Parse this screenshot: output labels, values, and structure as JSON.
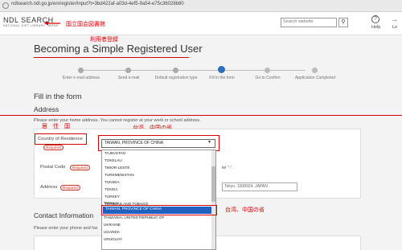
{
  "browser": {
    "url": "ndlsearch.ndl.go.jp/en/register/input?t=3bd422af-a03d-4ef5-9a54-e75c36028b80"
  },
  "header": {
    "logo": "NDL SEARCH",
    "logo_sub": "NATIONAL DIET LIBRARY, JAPAN",
    "search_placeholder": "Search website",
    "search_icon": "magnifier-icon",
    "help_label": "Help",
    "login_label": "Lo"
  },
  "annotations": {
    "ndl": "国立国会図書館",
    "user_reg": "利用者登録",
    "residence": "居　住　国",
    "taiwan_top": "台湾、中国の省",
    "taiwan_bottom": "台湾、中国の省",
    "color": "#d40000"
  },
  "page": {
    "title": "Becoming a Simple Registered User"
  },
  "steps": [
    {
      "label": "Enter e-mail address",
      "state": "done"
    },
    {
      "label": "Send e-mail",
      "state": "done"
    },
    {
      "label": "Default registration type",
      "state": "done"
    },
    {
      "label": "Fill in the form",
      "state": "current"
    },
    {
      "label": "Go to Confirm",
      "state": "todo"
    },
    {
      "label": "Application Completed",
      "state": "todo"
    }
  ],
  "form": {
    "heading": "Fill in the form",
    "address_heading": "Address",
    "address_note": "Please enter your home address. You cannot register at your work or school address.",
    "country_label": "Country of Residence",
    "postal_label": "Postal Code",
    "address_label": "Address",
    "required_badge": "Required",
    "country_value": "TAIWAN, PROVINCE OF CHINA",
    "hint_text": "ter \"-\".",
    "address_placeholder": "Tokyo, 1008924, JAPAN",
    "accent": "#2b6fb6"
  },
  "dropdown": {
    "options": [
      "TAJIKISTAN",
      "TOKELAU",
      "TIMOR-LESTE",
      "TURKMENISTAN",
      "TUNISIA",
      "TONGA",
      "TURKEY",
      "TRINIDAD AND TOBAGO",
      "TUVALU",
      "TAIWAN, PROVINCE OF CHINA",
      "TANZANIA, UNITED REPUBLIC OF",
      "UKRAINE",
      "UGANDA",
      "URUGUAY"
    ],
    "selected": "TAIWAN, PROVINCE OF CHINA",
    "selected_color": "#2060c0"
  },
  "contact": {
    "heading": "Contact Information",
    "note": "Please enter your phone and fax"
  }
}
